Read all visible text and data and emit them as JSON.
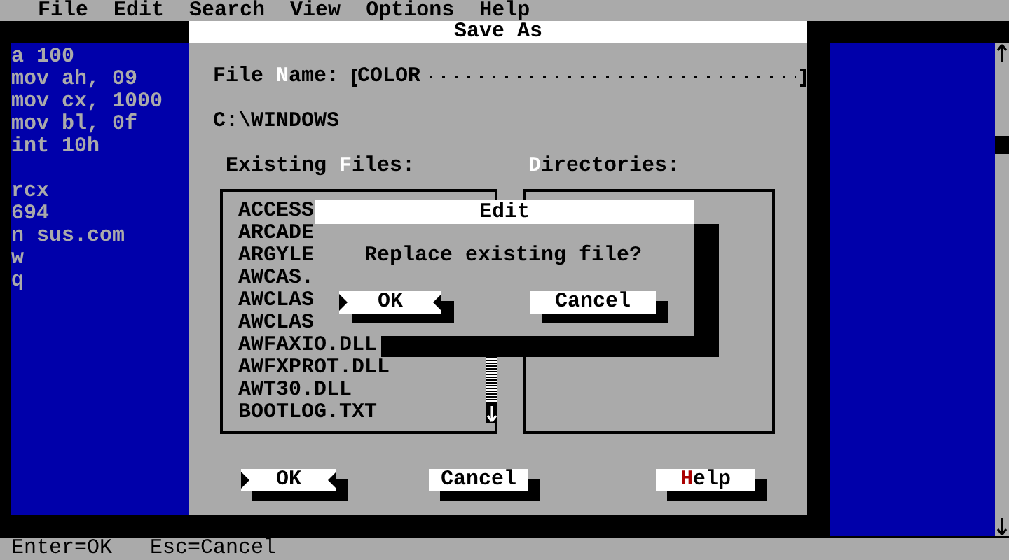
{
  "menu_bar": [
    {
      "label": "File"
    },
    {
      "label": "Edit"
    },
    {
      "label": "Search"
    },
    {
      "label": "View"
    },
    {
      "label": "Options"
    },
    {
      "label": "Help"
    }
  ],
  "editor": {
    "blocks": [
      [
        "a 100",
        "mov ah, 09",
        "mov cx, 1000",
        "mov bl, 0f",
        "int 10h"
      ],
      [
        "rcx",
        "694",
        "n sus.com",
        "w",
        "q"
      ]
    ]
  },
  "save_as_dialog": {
    "title": "Save As",
    "file_name": {
      "label_parts": [
        {
          "text": "File ",
          "hotkey": false
        },
        {
          "text": "N",
          "hotkey": true
        },
        {
          "text": "ame:",
          "hotkey": false
        }
      ],
      "value": "COLOR"
    },
    "path": "C:\\WINDOWS",
    "files_label": [
      {
        "text": "Existing ",
        "hotkey": false
      },
      {
        "text": "F",
        "hotkey": true
      },
      {
        "text": "iles:",
        "hotkey": false
      }
    ],
    "directories_label": [
      {
        "text": "D",
        "hotkey": true
      },
      {
        "text": "irectories:",
        "hotkey": false
      }
    ],
    "files": [
      "ACCESS",
      "ARCADE",
      "ARGYLE",
      "AWCAS.",
      "AWCLAS",
      "AWCLAS",
      "AWFAXIO.DLL",
      "AWFXPROT.DLL",
      "AWT30.DLL",
      "BOOTLOG.TXT"
    ],
    "buttons": [
      {
        "label_parts": [
          {
            "text": "OK",
            "hotkey": false
          }
        ],
        "focused": true
      },
      {
        "label_parts": [
          {
            "text": "Cancel",
            "hotkey": false
          }
        ],
        "focused": false
      },
      {
        "label_parts": [
          {
            "text": "H",
            "hotkey": true
          },
          {
            "text": "elp",
            "hotkey": false
          }
        ],
        "focused": false
      }
    ]
  },
  "edit_dialog": {
    "title": "Edit",
    "message": "Replace existing file?",
    "buttons": [
      {
        "label": "OK",
        "focused": true
      },
      {
        "label": "Cancel",
        "focused": false
      }
    ]
  },
  "status_bar": [
    "Enter=OK",
    "Esc=Cancel"
  ]
}
